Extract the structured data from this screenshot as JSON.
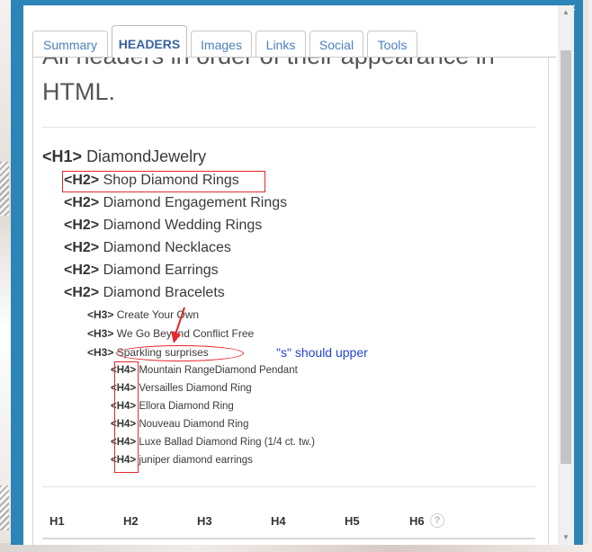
{
  "tabs": [
    {
      "label": "Summary",
      "active": false
    },
    {
      "label": "HEADERS",
      "active": true
    },
    {
      "label": "Images",
      "active": false
    },
    {
      "label": "Links",
      "active": false
    },
    {
      "label": "Social",
      "active": false
    },
    {
      "label": "Tools",
      "active": false
    }
  ],
  "intro": "All headers in order of their appearance in HTML.",
  "headers": [
    {
      "tag": "<H1>",
      "text": "DiamondJewelry"
    },
    {
      "tag": "<H2>",
      "text": "Shop Diamond Rings"
    },
    {
      "tag": "<H2>",
      "text": "Diamond Engagement Rings"
    },
    {
      "tag": "<H2>",
      "text": "Diamond Wedding Rings"
    },
    {
      "tag": "<H2>",
      "text": "Diamond Necklaces"
    },
    {
      "tag": "<H2>",
      "text": "Diamond Earrings"
    },
    {
      "tag": "<H2>",
      "text": "Diamond Bracelets"
    },
    {
      "tag": "<H3>",
      "text": "Create Your Own"
    },
    {
      "tag": "<H3>",
      "text": "We Go Beyond Conflict Free"
    },
    {
      "tag": "<H3>",
      "text": "Sparkling surprises"
    },
    {
      "tag": "<H4>",
      "text": "Mountain RangeDiamond Pendant"
    },
    {
      "tag": "<H4>",
      "text": "Versailles Diamond Ring"
    },
    {
      "tag": "<H4>",
      "text": "Ellora Diamond Ring"
    },
    {
      "tag": "<H4>",
      "text": "Nouveau Diamond Ring"
    },
    {
      "tag": "<H4>",
      "text": "Luxe Ballad Diamond Ring (1/4 ct. tw.)"
    },
    {
      "tag": "<H4>",
      "text": "juniper diamond earrings"
    }
  ],
  "annotation": "\"s\" should upper",
  "summary_headers": [
    "H1",
    "H2",
    "H3",
    "H4",
    "H5",
    "H6"
  ],
  "help_icon": "?",
  "close_icon": "×",
  "colors": {
    "frame": "#2d84b6",
    "tab_text": "#4c7fbb",
    "annotation_red": "#e8272c",
    "annotation_blue": "#2244cc"
  }
}
